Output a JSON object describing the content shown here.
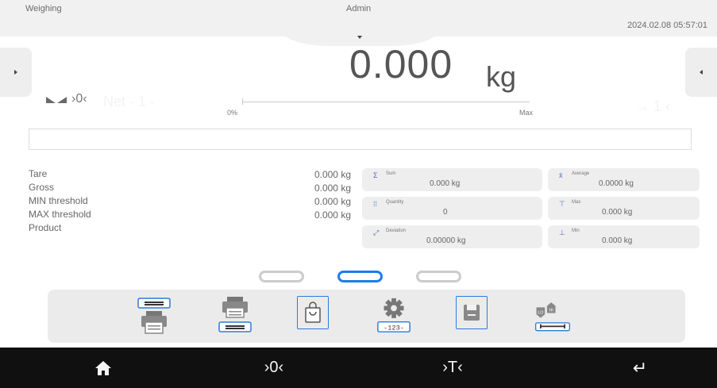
{
  "header": {
    "mode": "Weighing",
    "user": "Admin",
    "datetime": "2024.02.08 05:57:01"
  },
  "display": {
    "reading": "0.000",
    "unit": "kg",
    "zero_indicator": "›0‹",
    "ghost_left": "Net - 1 -",
    "ghost_right": "→ 1 ‹"
  },
  "bargraph": {
    "min_label": "0%",
    "max_label": "Max",
    "fill_fraction": 0
  },
  "info_field": {
    "text": ""
  },
  "params": [
    {
      "label": "Tare",
      "value": "0.000 kg"
    },
    {
      "label": "Gross",
      "value": "0.000 kg"
    },
    {
      "label": "MIN threshold",
      "value": "0.000 kg"
    },
    {
      "label": "MAX threshold",
      "value": "0.000 kg"
    },
    {
      "label": "Product",
      "value": ""
    }
  ],
  "stats": [
    {
      "key": "sum",
      "label": "Sum",
      "value": "0.000 kg",
      "icon": "sum-icon"
    },
    {
      "key": "average",
      "label": "Average",
      "value": "0.0000 kg",
      "icon": "average-icon"
    },
    {
      "key": "quantity",
      "label": "Quantity",
      "value": "0",
      "icon": "quantity-icon"
    },
    {
      "key": "max",
      "label": "Max",
      "value": "0.000 kg",
      "icon": "max-icon"
    },
    {
      "key": "deviation",
      "label": "Deviation",
      "value": "0.00000 kg",
      "icon": "deviation-icon"
    },
    {
      "key": "min",
      "label": "Min",
      "value": "0.000 kg",
      "icon": "min-icon"
    }
  ],
  "pager": {
    "pages": 3,
    "active_page": 2
  },
  "toolbar": {
    "items": [
      "printout-header-icon",
      "printout-footer-icon",
      "product-bag-icon",
      "settings-123-icon",
      "save-icon",
      "lo-hi-threshold-icon"
    ],
    "settings_digits": "-123-",
    "lo_label": "LO",
    "hi_label": "HI"
  },
  "nav": {
    "home": "home-icon",
    "zero": "›0‹",
    "tare": "›T‹",
    "enter": "↵"
  },
  "colors": {
    "accent": "#1e7de8",
    "topbar": "#f1f1f1",
    "navbar": "#101010",
    "card": "#eeeeee"
  }
}
